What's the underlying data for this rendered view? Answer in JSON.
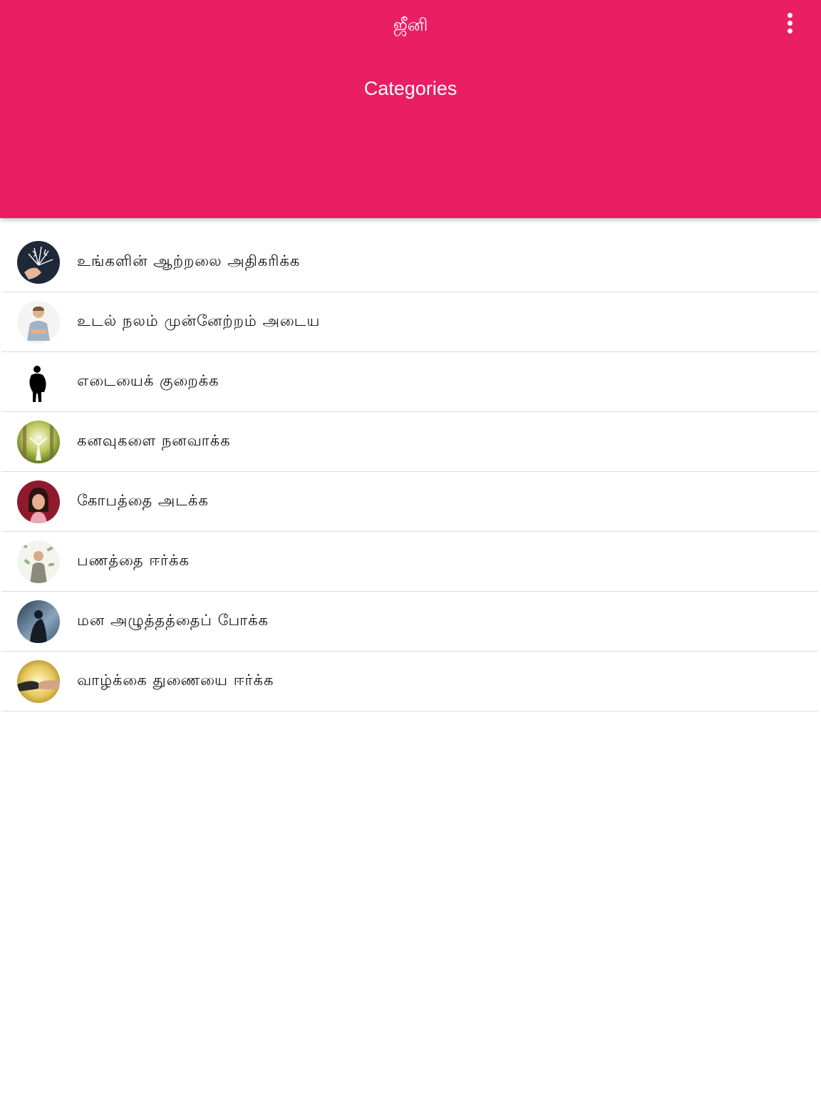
{
  "header": {
    "app_title": "ஜீனி",
    "page_title": "Categories",
    "menu_icon": "more-vert-icon",
    "color": "#E91E63"
  },
  "categories": [
    {
      "label": "உங்களின் ஆற்றலை அதிகரிக்க",
      "icon": "energy-hand-icon"
    },
    {
      "label": "உடல் நலம் முன்னேற்றம் அடைய",
      "icon": "fit-man-icon"
    },
    {
      "label": "எடையைக் குறைக்க",
      "icon": "weight-silhouette-icon"
    },
    {
      "label": "கனவுகளை நனவாக்க",
      "icon": "dream-forest-icon"
    },
    {
      "label": "கோபத்தை அடக்க",
      "icon": "angry-girl-icon"
    },
    {
      "label": "பணத்தை ஈர்க்க",
      "icon": "money-rain-icon"
    },
    {
      "label": "மன அழுத்தத்தைப் போக்க",
      "icon": "stressed-person-icon"
    },
    {
      "label": "வாழ்க்கை துணையை ஈர்க்க",
      "icon": "holding-hands-icon"
    }
  ]
}
